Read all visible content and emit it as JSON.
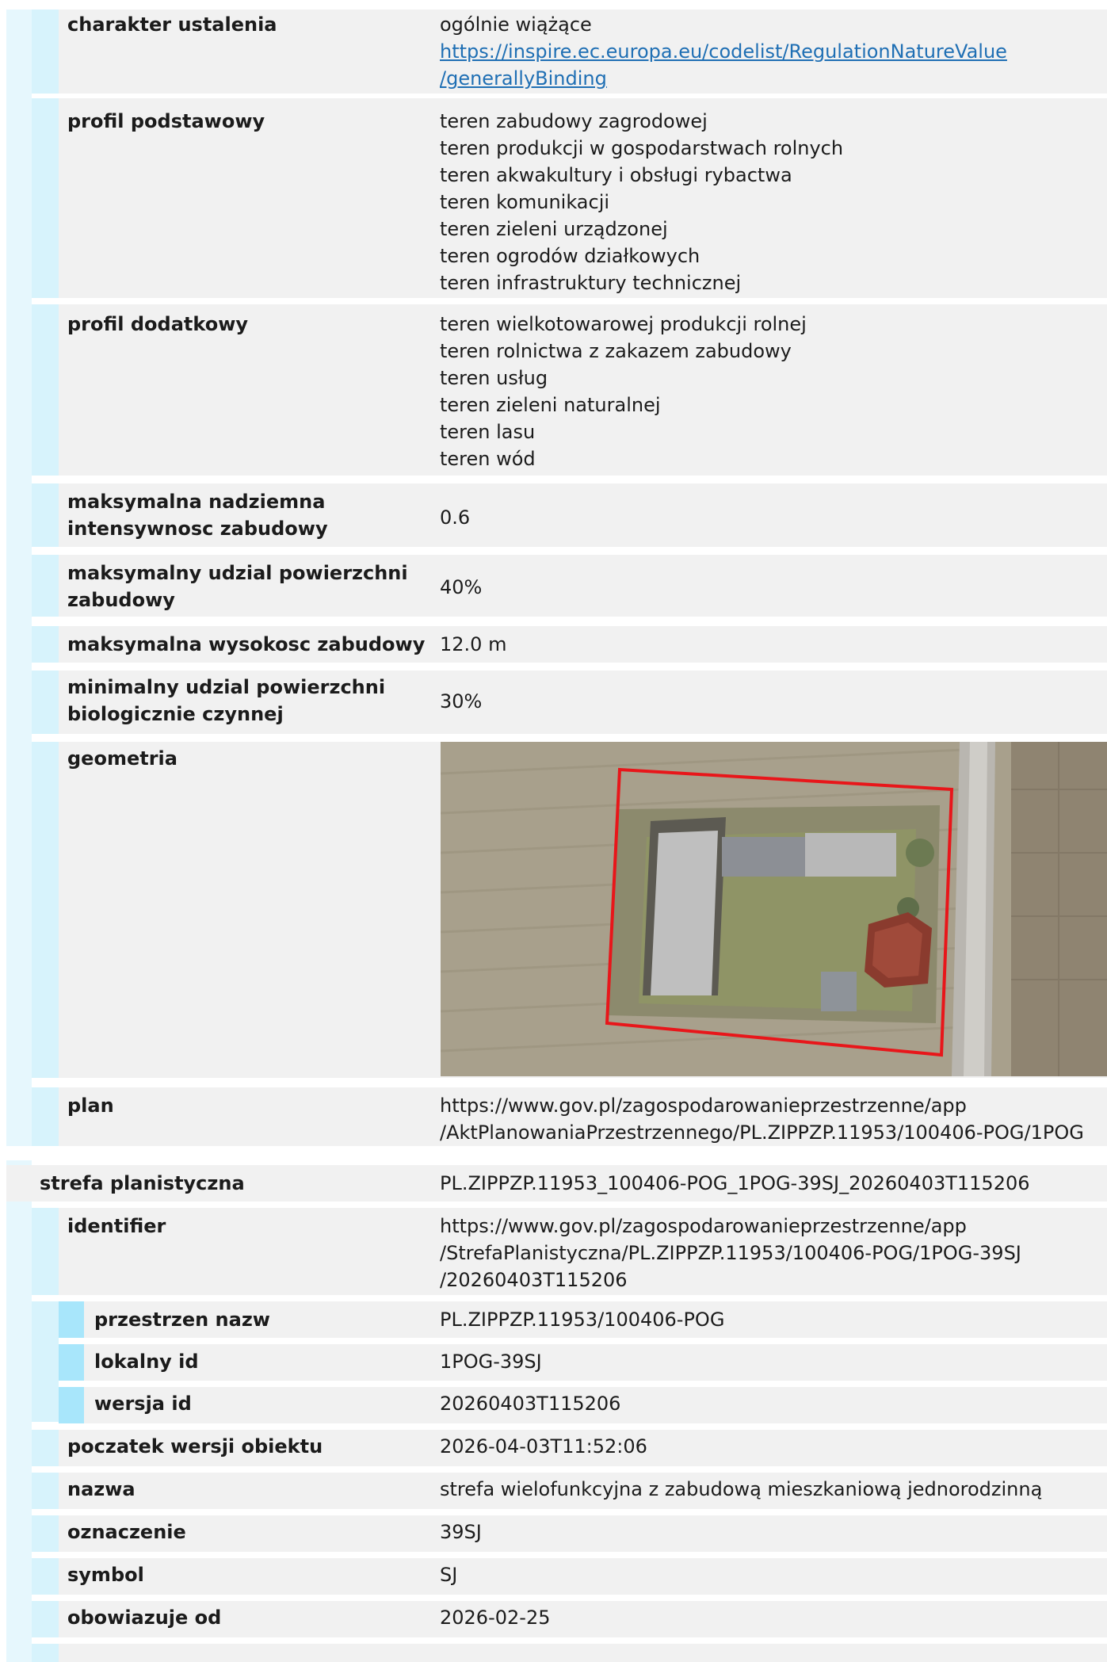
{
  "section1": {
    "rows": [
      {
        "label": "charakter ustalenia",
        "values": [
          "ogólnie wiążące"
        ],
        "links": [
          "https://inspire.ec.europa.eu/codelist/RegulationNatureValue",
          "/generallyBinding"
        ]
      },
      {
        "label": "profil podstawowy",
        "values": [
          "teren zabudowy zagrodowej",
          "teren produkcji w gospodarstwach rolnych",
          "teren akwakultury i obsługi rybactwa",
          "teren komunikacji",
          "teren zieleni urządzonej",
          "teren ogrodów działkowych",
          "teren infrastruktury technicznej"
        ]
      },
      {
        "label": "profil dodatkowy",
        "values": [
          "teren wielkotowarowej produkcji rolnej",
          "teren rolnictwa z zakazem zabudowy",
          "teren usług",
          "teren zieleni naturalnej",
          "teren lasu",
          "teren wód"
        ]
      },
      {
        "label_lines": [
          "maksymalna nadziemna",
          "intensywnosc zabudowy"
        ],
        "value": "0.6"
      },
      {
        "label_lines": [
          "maksymalny udzial powierzchni",
          "zabudowy"
        ],
        "value": "40%"
      },
      {
        "label": "maksymalna wysokosc zabudowy",
        "value": "12.0 m"
      },
      {
        "label_lines": [
          "minimalny udzial powierzchni",
          "biologicznie czynnej"
        ],
        "value": "30%"
      },
      {
        "label": "geometria",
        "image": "aerial-photo-with-red-polygon"
      },
      {
        "label": "plan",
        "values": [
          "https://www.gov.pl/zagospodarowanieprzestrzenne/app",
          "/AktPlanowaniaPrzestrzennego/PL.ZIPPZP.11953/100406-POG/1POG"
        ]
      }
    ]
  },
  "section2": {
    "title": "strefa planistyczna",
    "title_value": "PL.ZIPPZP.11953_100406-POG_1POG-39SJ_20260403T115206",
    "identifier": {
      "label": "identifier",
      "values": [
        "https://www.gov.pl/zagospodarowanieprzestrzenne/app",
        "/StrefaPlanistyczna/PL.ZIPPZP.11953/100406-POG/1POG-39SJ",
        "/20260403T115206"
      ],
      "sub": [
        {
          "label": "przestrzen nazw",
          "value": "PL.ZIPPZP.11953/100406-POG"
        },
        {
          "label": "lokalny id",
          "value": "1POG-39SJ"
        },
        {
          "label": "wersja id",
          "value": "20260403T115206"
        }
      ]
    },
    "rows": [
      {
        "label": "poczatek wersji obiektu",
        "value": "2026-04-03T11:52:06"
      },
      {
        "label": "nazwa",
        "value": "strefa wielofunkcyjna z zabudową mieszkaniową jednorodzinną"
      },
      {
        "label": "oznaczenie",
        "value": "39SJ"
      },
      {
        "label": "symbol",
        "value": "SJ"
      },
      {
        "label": "obowiazuje od",
        "value": "2026-02-25"
      }
    ]
  },
  "colors": {
    "row_bg": "#f1f1f1",
    "indent_bar": "#d7f3fc",
    "sub_indent_bar": "#a8e6fb",
    "link": "#1f6fb4",
    "polygon": "#e8161a"
  }
}
